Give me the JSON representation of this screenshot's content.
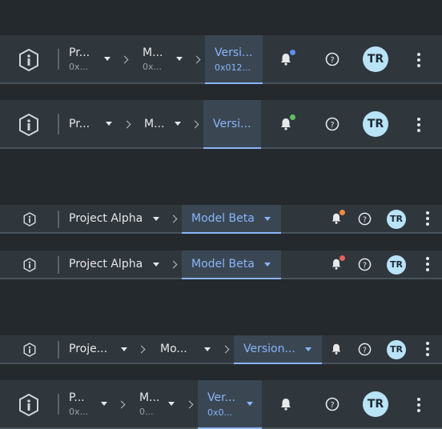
{
  "toolbars": [
    {
      "project_title": "Pr...",
      "project_sub": "0x...",
      "model_title": "M...",
      "model_sub": "0x...",
      "version_title": "Versi...",
      "version_sub": "0x012...",
      "notification_dot_color": "#5b8def",
      "avatar_initials": "TR"
    },
    {
      "project_title": "Pr...",
      "model_title": "M...",
      "version_title": "Versi...",
      "notification_dot_color": "#5fbf5f",
      "avatar_initials": "TR"
    },
    {
      "project_title": "Project Alpha",
      "model_title": "Model Beta",
      "notification_dot_color": "#f08a3e",
      "avatar_initials": "TR"
    },
    {
      "project_title": "Project Alpha",
      "model_title": "Model Beta",
      "notification_dot_color": "#e8605a",
      "avatar_initials": "TR"
    },
    {
      "project_title": "Proje...",
      "model_title": "Mo...",
      "version_title": "Version...",
      "avatar_initials": "TR"
    },
    {
      "project_title": "P...",
      "project_sub": "0x...",
      "model_title": "M...",
      "model_sub": "0...",
      "version_title": "Ver...",
      "version_sub": "0x0...",
      "avatar_initials": "TR"
    }
  ],
  "colors": {
    "accent": "#8ab4f8",
    "background": "#24292e",
    "toolbar": "#2f363c",
    "avatar": "#b9e3f6"
  },
  "icons": [
    "info-logo-icon",
    "chevron-right-icon",
    "caret-down-icon",
    "bell-icon",
    "help-icon",
    "more-vert-icon"
  ]
}
